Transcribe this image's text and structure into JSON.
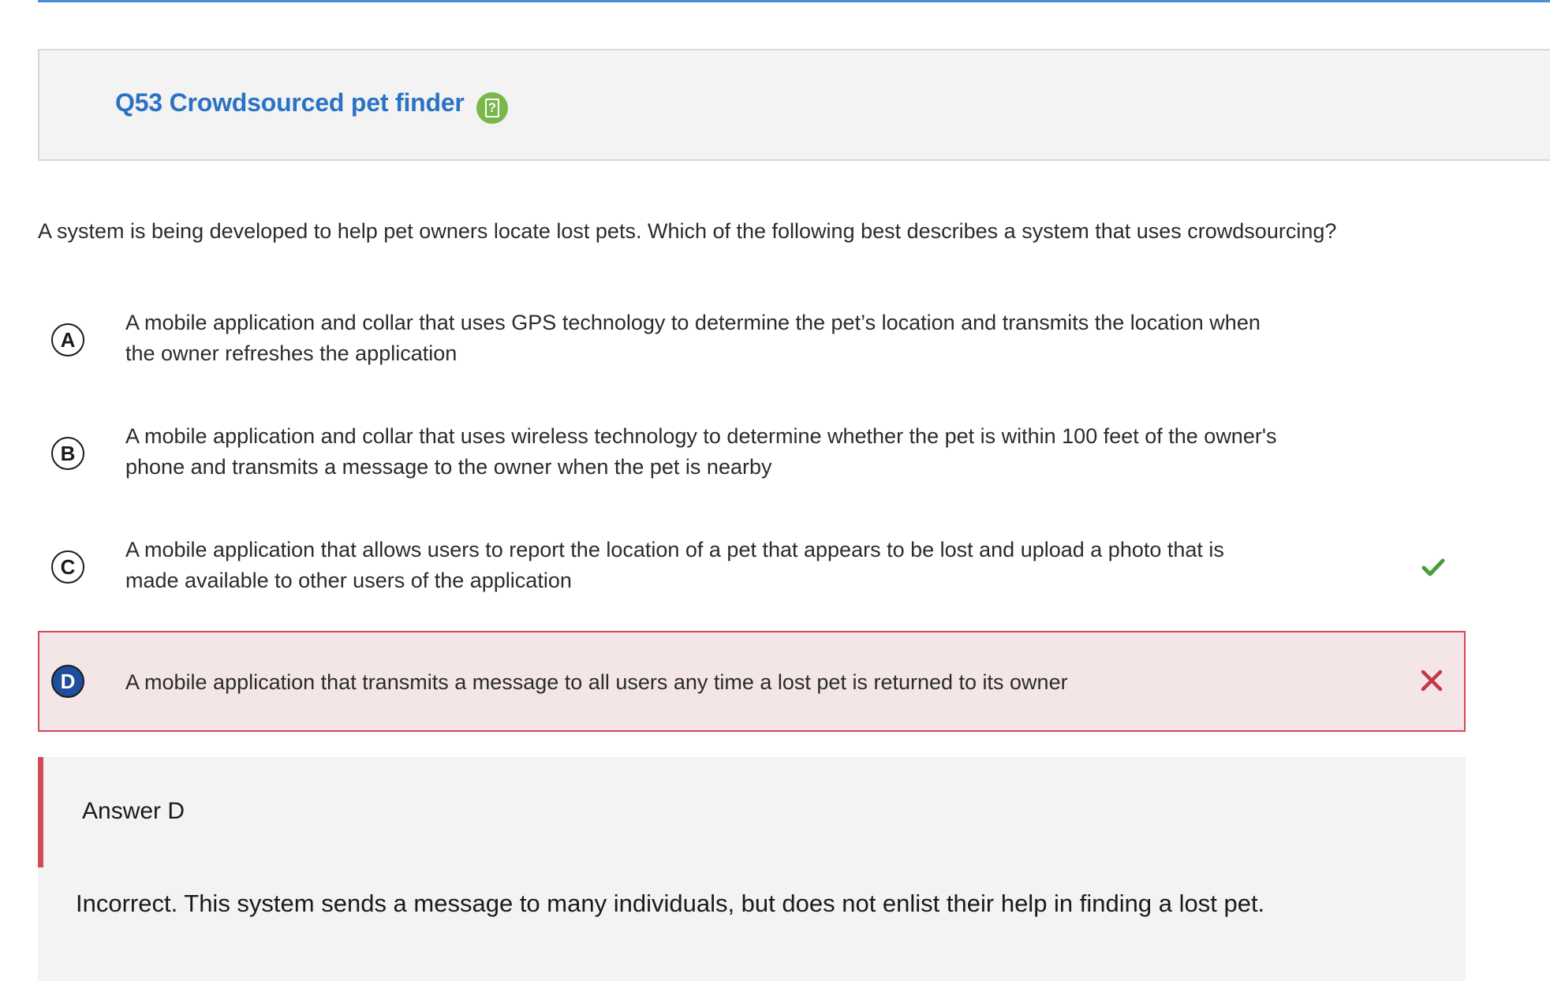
{
  "question": {
    "title": "Q53 Crowdsourced pet finder",
    "help_icon": "help-icon",
    "prompt": "A system is being developed to help pet owners locate lost pets. Which of the following best describes a system that uses crowdsourcing?"
  },
  "choices": [
    {
      "letter": "A",
      "text": "A mobile application and collar that uses GPS technology to determine the pet’s location and transmits the location when the owner refreshes the application",
      "state": "unselected"
    },
    {
      "letter": "B",
      "text": "A mobile application and collar that uses wireless technology to determine whether the pet is within 100 feet of the owner's phone and transmits a message to the owner when the pet is nearby",
      "state": "unselected"
    },
    {
      "letter": "C",
      "text": "A mobile application that allows users to report the location of a pet that appears to be lost and upload a photo that is made available to other users of the application",
      "state": "correct",
      "status_icon": "check-icon"
    },
    {
      "letter": "D",
      "text": "A mobile application that transmits a message to all users any time a lost pet is returned to its owner",
      "state": "selected-incorrect",
      "status_icon": "x-icon"
    }
  ],
  "feedback": {
    "answer_label": "Answer D",
    "explanation": "Incorrect. This system sends a message to many individuals, but does not enlist their help in finding a lost pet."
  },
  "colors": {
    "accent_blue": "#4a90d9",
    "title_blue": "#2a72c4",
    "help_green": "#7ab648",
    "correct_green": "#4a9e3a",
    "incorrect_red": "#d04a57",
    "incorrect_bg": "#f4e6e7",
    "selected_letter_bg": "#1f4e9c",
    "panel_bg": "#f3f3f3"
  }
}
